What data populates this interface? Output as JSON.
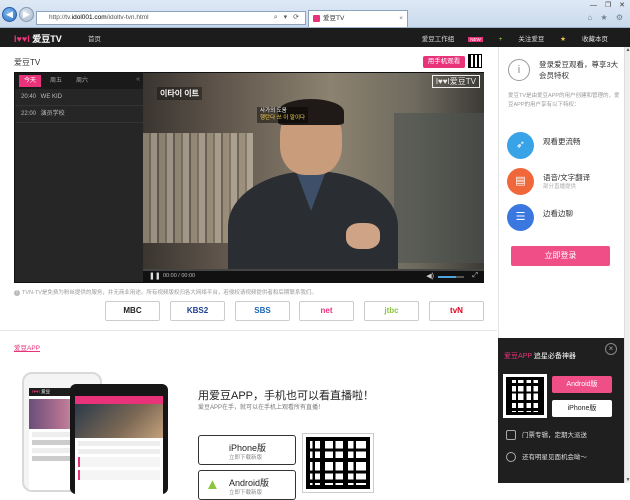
{
  "browser": {
    "url_prefix": "http://tv.",
    "url_host": "idol001.com",
    "url_path": "/idoltv-tvn.html",
    "tab_title": "爱豆TV",
    "tab_close": "×",
    "window_controls": "— ❐ ✕",
    "chrome_icons": "⌂ ★ ⚙",
    "addr_icons": "⌕ ▾ ⟳"
  },
  "header": {
    "logo_mark": "I♥♥I",
    "logo_text": "爱豆TV",
    "home": "首页",
    "studio": "爱豆工作组",
    "new_badge": "NEW",
    "follow_icon": "+",
    "follow": "关注爱豆",
    "favorite": "收藏本页"
  },
  "main": {
    "title": "爱豆TV",
    "phone_watch": "用手机观看"
  },
  "schedule": {
    "tabs": [
      "今天",
      "周五",
      "周六"
    ],
    "collapse": "«",
    "rows": [
      {
        "time": "20:40",
        "title": "WE KID"
      },
      {
        "time": "22:00",
        "title": "演员学校"
      }
    ]
  },
  "video": {
    "caption": "이타이 이트",
    "caption_top": "사가의 도움",
    "caption_hl": "행탄다 쓰 이 말이다",
    "watermark": "I♥♥I爱豆TV",
    "time": "00:00 / 00:00",
    "progress": 0,
    "volume": 0.7
  },
  "notice": "TVN-TV是免费为粉丝提供的服务，并无商业用途。所有视频版权归各大网络平台，若侵权请视频提供者和后期联系我们。",
  "channels": [
    "MBC",
    "KBS2",
    "SBS",
    "net",
    "jtbc",
    "tvN"
  ],
  "channel_colors": [
    "#222222",
    "#1d3f8f",
    "#1b65b5",
    "#e8327a",
    "#8cc63f",
    "#e5001a"
  ],
  "app_section": {
    "link": "爱豆APP",
    "title": "用爱豆APP，手机也可以看直播啦！",
    "subtitle": "爱豆APP在手，就可以在手机上观看所有直播！",
    "iphone_name": "iPhone版",
    "iphone_dl": "立即下载新版",
    "android_name": "Android版",
    "android_dl": "立即下载新版",
    "phone_brand_mark": "I♥♥I",
    "phone_brand": "爱豆"
  },
  "sidebar": {
    "info_icon": "i",
    "heading": "登录爱豆观看，尊享3大会员特权",
    "description": "爱豆TV是由爱豆APP的用户创建和管理的，爱豆APP的用户享有以下特权：",
    "features": [
      {
        "label": "观看更流畅",
        "sub": "",
        "icon": "rocket-icon",
        "color": "#39a3e8"
      },
      {
        "label": "语音/文字翻译",
        "sub": "部分直播提供",
        "icon": "translate-icon",
        "color": "#f0683a"
      },
      {
        "label": "边看边聊",
        "sub": "",
        "icon": "chat-icon",
        "color": "#3a78e0"
      }
    ],
    "login": "立即登录"
  },
  "download_panel": {
    "brand": "爱豆APP",
    "title": " 追星必备神器",
    "close": "×",
    "android": "Android版",
    "iphone": "iPhone版",
    "row1": "门票专辑，定期大派送",
    "row2": "还有明星见面机会呦～"
  },
  "scrollbar": {
    "up": "▲",
    "down": "▼"
  }
}
